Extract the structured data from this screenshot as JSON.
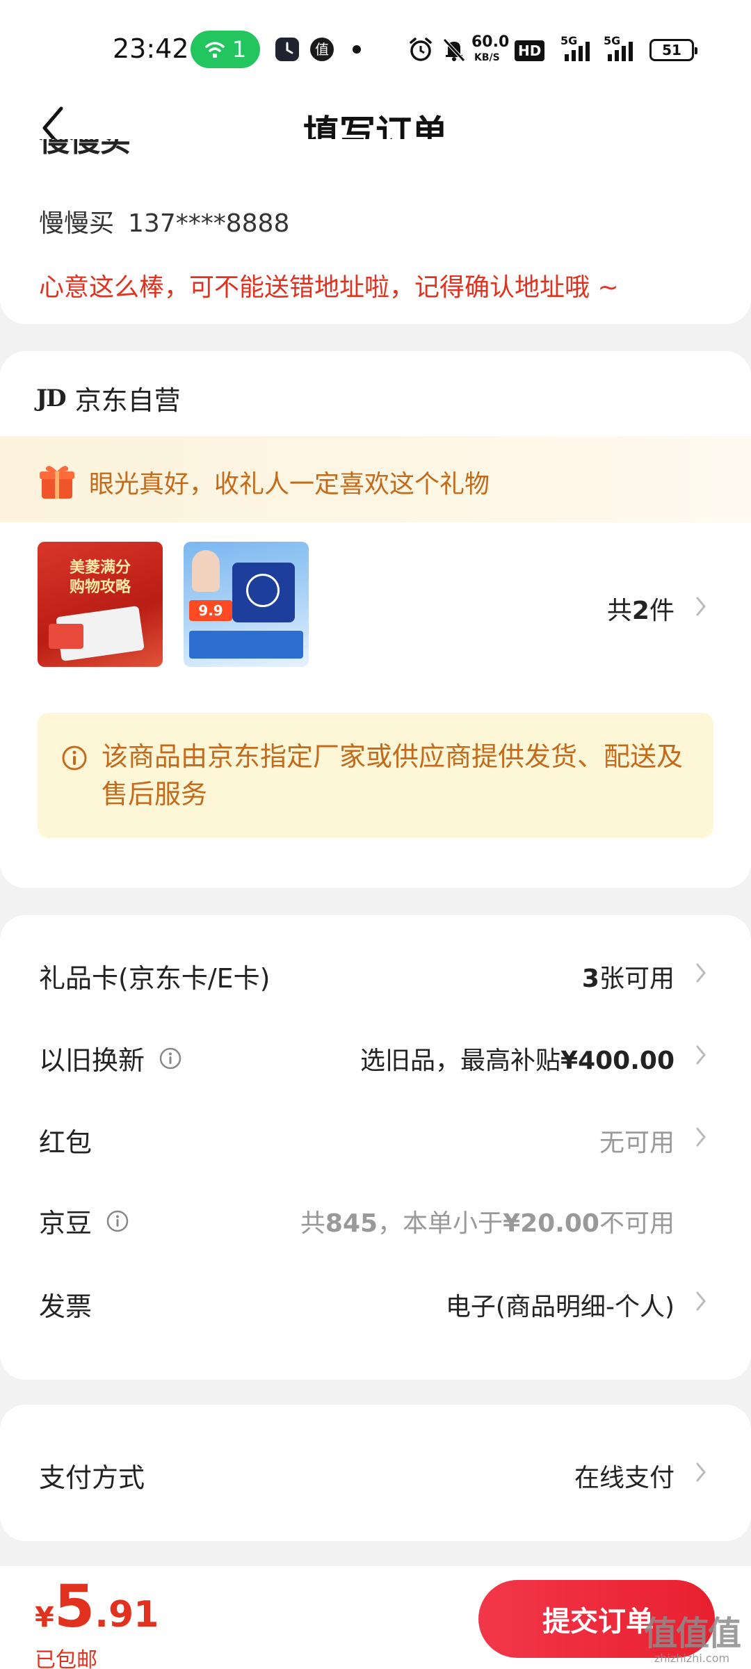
{
  "status_bar": {
    "time": "23:42",
    "wifi_badge": "1",
    "speed_value": "60.0",
    "speed_unit": "KB/S",
    "hd": "HD",
    "net1": "5G",
    "net2": "5G",
    "battery": "51"
  },
  "header": {
    "title": "填写订单"
  },
  "address": {
    "partial_line": "慢慢买",
    "name": "慢慢买",
    "phone": "137****8888",
    "hint": "心意这么棒，可不能送错地址啦，记得确认地址哦 ~"
  },
  "shop": {
    "logo": "JD",
    "name": "京东自营",
    "gift_banner": "眼光真好，收礼人一定喜欢这个礼物",
    "count_prefix": "共",
    "count_num": "2",
    "count_suffix": "件",
    "thumb1_title_line1": "美菱满分",
    "thumb1_title_line2": "购物攻略",
    "thumb2_tag": "9.9",
    "notice": "该商品由京东指定厂家或供应商提供发货、配送及售后服务"
  },
  "options": {
    "gift_card": {
      "label": "礼品卡(京东卡/E卡)",
      "value_bold": "3",
      "value_rest": "张可用"
    },
    "trade_in": {
      "label": "以旧换新",
      "value_prefix": "选旧品，最高补贴",
      "value_bold": "¥400.00"
    },
    "red_packet": {
      "label": "红包",
      "value": "无可用"
    },
    "jingdou": {
      "label": "京豆",
      "value_prefix": "共",
      "value_count": "845",
      "value_mid": "，本单小于",
      "value_amount": "¥20.00",
      "value_suffix": "不可用"
    },
    "invoice": {
      "label": "发票",
      "value": "电子(商品明细-个人)"
    }
  },
  "payment": {
    "label": "支付方式",
    "value": "在线支付"
  },
  "footer": {
    "currency": "¥",
    "price_int": "5",
    "price_dec": ".91",
    "shipping": "已包邮",
    "submit_label": "提交订单",
    "watermark": "值值值",
    "watermark_domain": "zhizhizhi.com"
  },
  "colors": {
    "accent_red": "#e0321e",
    "notice_orange": "#c46a1b",
    "submit_red": "#e8202f"
  }
}
